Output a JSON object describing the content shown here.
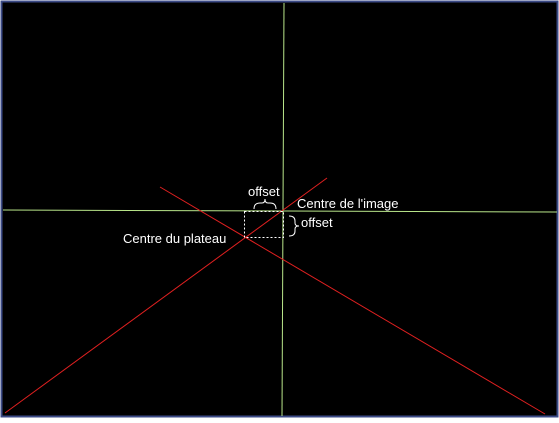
{
  "labels": {
    "offset_horizontal": "offset",
    "offset_vertical": "offset",
    "image_center": "Centre de l'image",
    "plate_center": "Centre du plateau"
  },
  "colors": {
    "background": "#000000",
    "border": "#3b4a86",
    "image_axes": "#b9e68a",
    "plate_lines": "#e02020",
    "offset_box": "#ffffff",
    "text": "#ffffff"
  }
}
